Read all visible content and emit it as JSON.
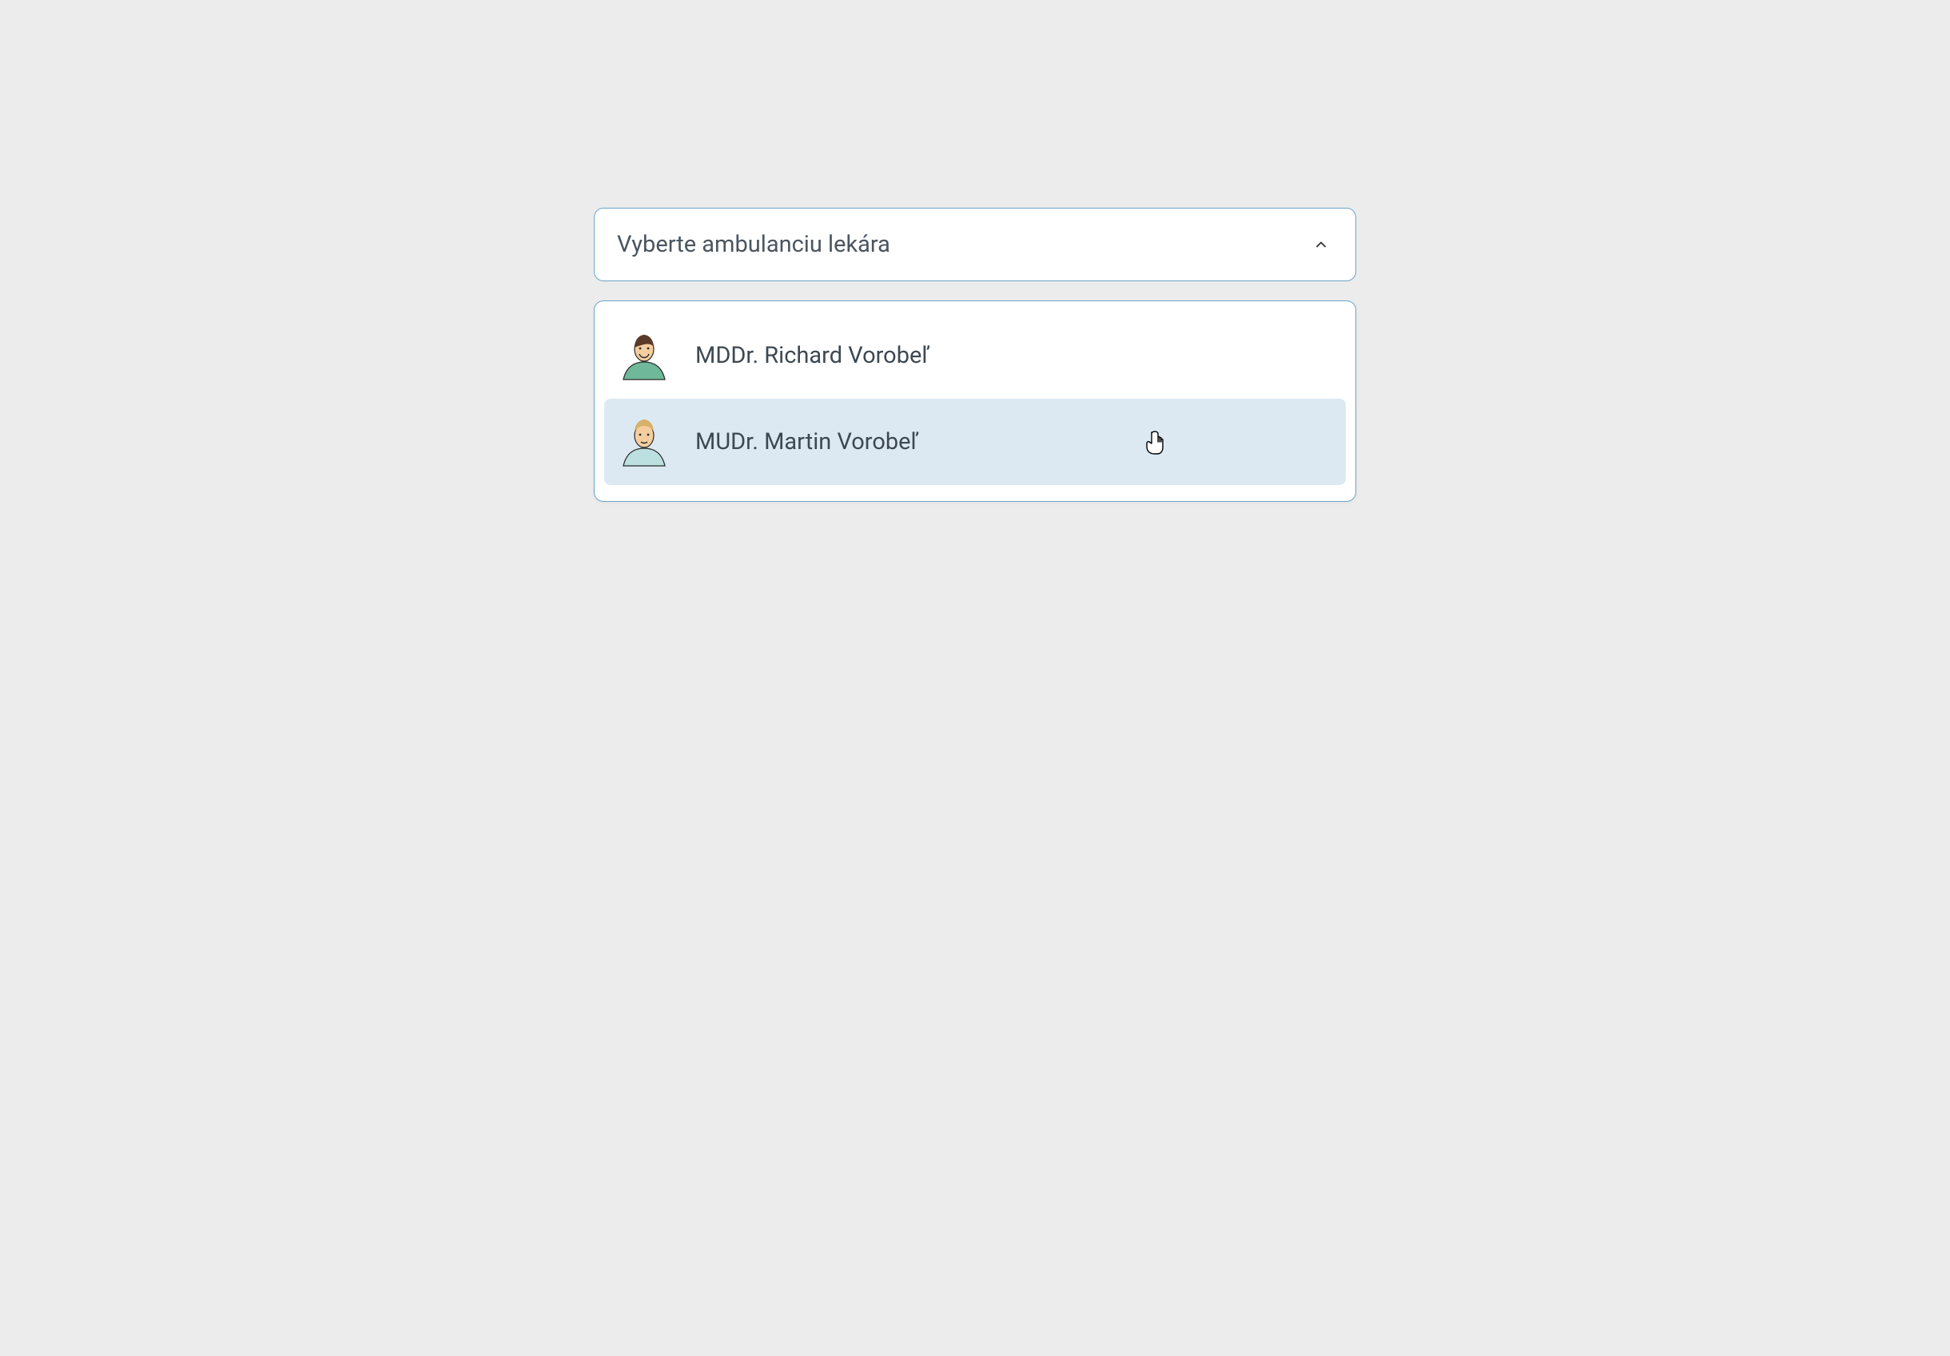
{
  "dropdown": {
    "placeholder": "Vyberte ambulanciu lekára",
    "options": [
      {
        "label": "MDDr. Richard Vorobeľ"
      },
      {
        "label": "MUDr. Martin Vorobeľ"
      }
    ]
  }
}
